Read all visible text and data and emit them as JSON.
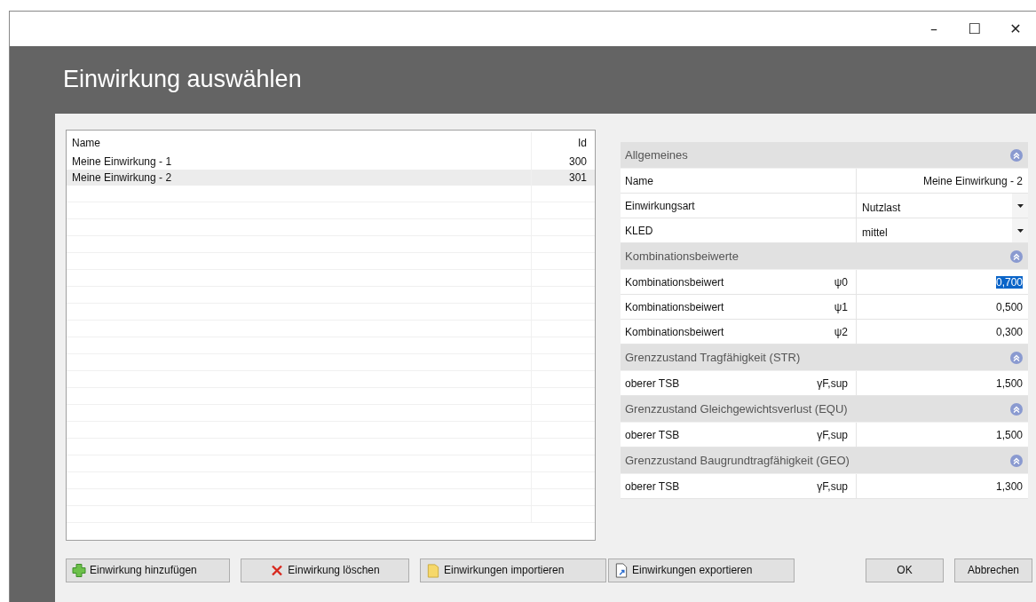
{
  "window": {
    "title": "Einwirkung auswählen",
    "controls": [
      "–",
      "☐",
      "✕"
    ]
  },
  "list": {
    "columns": [
      "Name",
      "Id"
    ],
    "rows": [
      {
        "name": "Meine Einwirkung - 1",
        "id": "300",
        "selected": false
      },
      {
        "name": "Meine Einwirkung - 2",
        "id": "301",
        "selected": true
      }
    ]
  },
  "properties": [
    {
      "title": "Allgemeines",
      "expanded": true,
      "rows": [
        {
          "label": "Name",
          "value": "Meine Einwirkung - 2",
          "kind": "text"
        },
        {
          "label": "Einwirkungsart",
          "value": "Nutzlast",
          "kind": "dropdown"
        },
        {
          "label": "KLED",
          "value": "mittel",
          "kind": "dropdown"
        }
      ]
    },
    {
      "title": "Kombinationsbeiwerte",
      "expanded": true,
      "rows": [
        {
          "label": "Kombinationsbeiwert",
          "symbol": "ψ0",
          "value": "0,700",
          "kind": "number",
          "selected": true
        },
        {
          "label": "Kombinationsbeiwert",
          "symbol": "ψ1",
          "value": "0,500",
          "kind": "number",
          "selected": false
        },
        {
          "label": "Kombinationsbeiwert",
          "symbol": "ψ2",
          "value": "0,300",
          "kind": "number",
          "selected": false
        }
      ]
    },
    {
      "title": "Grenzzustand Tragfähigkeit (STR)",
      "expanded": true,
      "rows": [
        {
          "label": "oberer TSB",
          "symbol": "γF,sup",
          "value": "1,500",
          "kind": "number",
          "selected": false
        }
      ]
    },
    {
      "title": "Grenzzustand Gleichgewichtsverlust (EQU)",
      "expanded": true,
      "rows": [
        {
          "label": "oberer TSB",
          "symbol": "γF,sup",
          "value": "1,500",
          "kind": "number",
          "selected": false
        }
      ]
    },
    {
      "title": "Grenzzustand Baugrundtragfähigkeit (GEO)",
      "expanded": true,
      "rows": [
        {
          "label": "oberer TSB",
          "symbol": "γF,sup",
          "value": "1,300",
          "kind": "number",
          "selected": false
        }
      ]
    }
  ],
  "buttons": [
    {
      "label": "Einwirkung hinzufügen",
      "kind": "add"
    },
    {
      "label": "Einwirkung löschen",
      "kind": "delete"
    },
    {
      "label": "Einwirkungen importieren",
      "kind": "import"
    },
    {
      "label": "Einwirkungen exportieren",
      "kind": "export"
    }
  ],
  "dialog_buttons": [
    "OK",
    "Abbrechen"
  ]
}
